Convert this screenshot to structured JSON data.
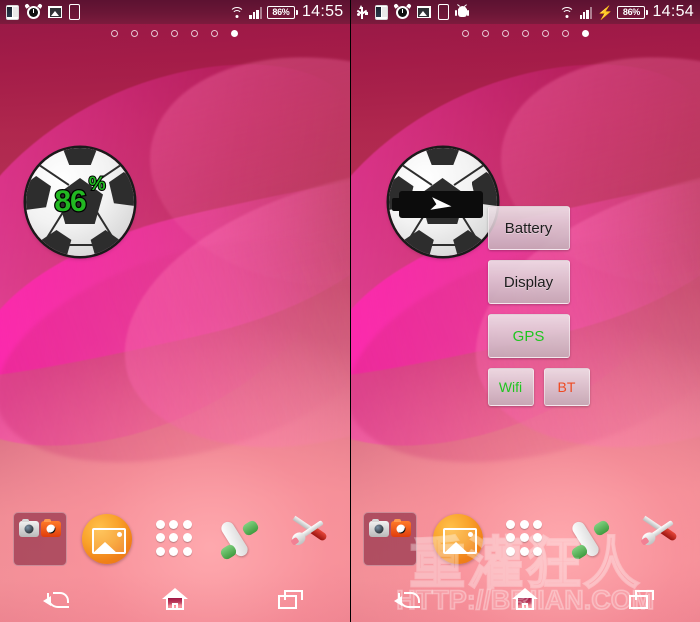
{
  "screens": [
    {
      "id": "left",
      "status_bar": {
        "left_icons": [
          "phone-icon",
          "alarm-clock-icon",
          "image-icon",
          "device-icon"
        ],
        "wifi_icon": "wifi-icon",
        "signal_icon": "signal-bars-icon",
        "charging": false,
        "battery_label": "86%",
        "clock": "14:55"
      },
      "page_indicator": {
        "count": 7,
        "active_index": 6
      },
      "widget": {
        "type": "soccer-ball-battery-widget",
        "percent_value": "86",
        "percent_symbol": "%",
        "percent_color": "#22b822",
        "charging": false
      },
      "buttons_panel": null
    },
    {
      "id": "right",
      "status_bar": {
        "left_icons": [
          "usb-icon",
          "phone-icon",
          "alarm-clock-icon",
          "image-icon",
          "device-icon",
          "android-robot-icon"
        ],
        "wifi_icon": "wifi-icon",
        "signal_icon": "signal-bars-icon",
        "charging": true,
        "charging_icon": "lightning-bolt-icon",
        "battery_label": "86%",
        "clock": "14:54"
      },
      "page_indicator": {
        "count": 7,
        "active_index": 6
      },
      "widget": {
        "type": "soccer-ball-battery-widget",
        "percent_value": "",
        "percent_symbol": "",
        "percent_color": "#22b822",
        "charging": true,
        "charging_icon": "lightning-bolt-icon"
      },
      "buttons_panel": {
        "items": [
          {
            "label": "Battery",
            "color": "#1d1d1d",
            "size": "wide"
          },
          {
            "label": "Display",
            "color": "#1d1d1d",
            "size": "wide"
          },
          {
            "label": "GPS",
            "color": "#1fc51f",
            "size": "wide"
          }
        ],
        "small_items": [
          {
            "label": "Wifi",
            "color": "#1fc51f"
          },
          {
            "label": "BT",
            "color": "#ee4a22"
          }
        ]
      }
    }
  ],
  "dock": {
    "items": [
      {
        "name": "camera-folder",
        "icon": "folder-camera-icon"
      },
      {
        "name": "gallery",
        "icon": "gallery-icon"
      },
      {
        "name": "app-drawer",
        "icon": "app-drawer-icon"
      },
      {
        "name": "phone",
        "icon": "phone-handset-icon"
      },
      {
        "name": "tools",
        "icon": "tools-icon"
      }
    ]
  },
  "nav_bar": {
    "back": "back-icon",
    "home": "home-icon",
    "recents": "recents-icon"
  },
  "watermark": {
    "chinese": "重灌狂人",
    "url": "HTTP://BRIIAN.COM"
  },
  "colors": {
    "accent_green": "#22b822",
    "accent_red": "#ee4a22",
    "status_bar_bg": "#6b1636",
    "wallpaper_top": "#8d1c46",
    "wallpaper_bottom": "#f08e96"
  }
}
